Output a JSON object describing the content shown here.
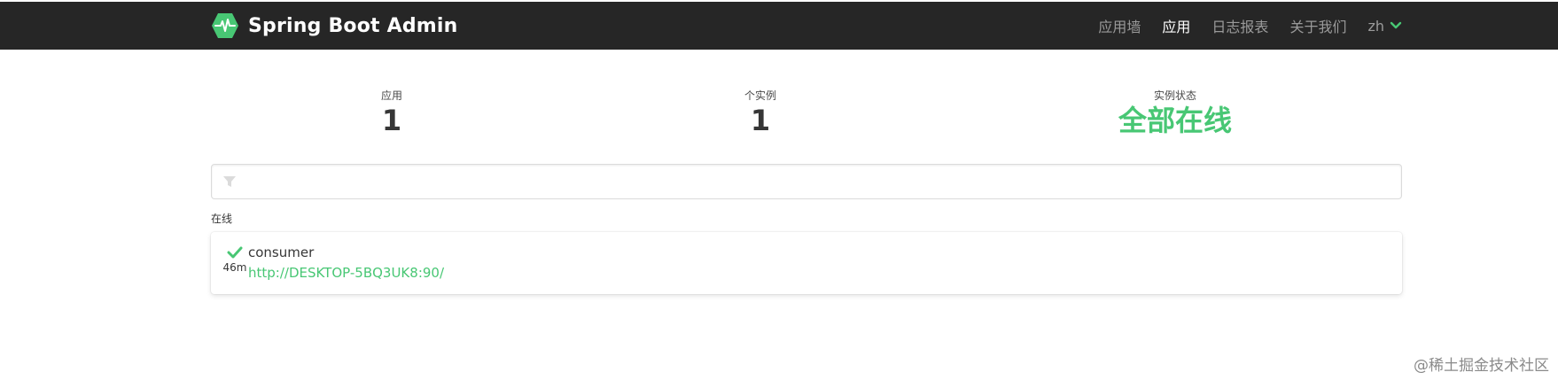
{
  "navbar": {
    "brand": "Spring Boot Admin",
    "links": [
      "应用墙",
      "应用",
      "日志报表",
      "关于我们"
    ],
    "active_link": "应用",
    "language": "zh"
  },
  "stats": {
    "applications_label": "应用",
    "applications_value": "1",
    "instances_label": "个实例",
    "instances_value": "1",
    "status_label": "实例状态",
    "status_value": "全部在线"
  },
  "filter": {
    "placeholder": "",
    "value": ""
  },
  "group": {
    "label": "在线",
    "applications": [
      {
        "name": "consumer",
        "url": "http://DESKTOP-5BQ3UK8:90/",
        "uptime": "46m"
      }
    ]
  },
  "watermark": "@稀土掘金技术社区",
  "colors": {
    "accent": "#48c774",
    "navbar": "#262626"
  },
  "icons": {
    "brand": "heartbeat-hexagon-icon",
    "language": "chevron-down-icon",
    "filter": "filter-icon",
    "status": "check-icon"
  }
}
